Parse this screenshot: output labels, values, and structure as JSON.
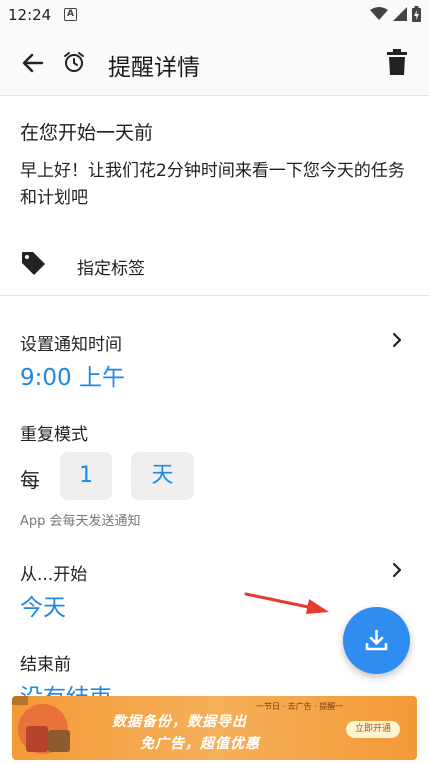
{
  "status_bar": {
    "time": "12:24"
  },
  "app_bar": {
    "title": "提醒详情"
  },
  "reminder": {
    "title": "在您开始一天前",
    "message": "早上好！让我们花2分钟时间来看一下您今天的任务和计划吧",
    "tag_label": "指定标签"
  },
  "notify": {
    "label": "设置通知时间",
    "value": "9:00 上午"
  },
  "repeat": {
    "label": "重复模式",
    "every": "每",
    "count": "1",
    "unit": "天",
    "hint": "App 会每天发送通知"
  },
  "start": {
    "label": "从...开始",
    "value": "今天"
  },
  "end": {
    "label": "结束前",
    "value": "没有结束"
  },
  "ad": {
    "top_text": "一节日 · 去广告 · 提醒一",
    "line1": "数据备份，数据导出",
    "line2": "免广告，超值优惠",
    "button": "立即开通"
  },
  "colors": {
    "accent": "#1e88e5",
    "fab": "#2f8cf0",
    "arrow": "#e53a2c"
  }
}
